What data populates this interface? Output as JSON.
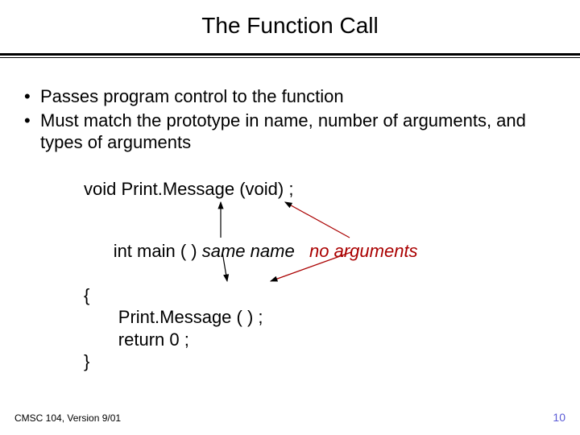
{
  "title": "The Function Call",
  "bullets": [
    "Passes program control to  the function",
    "Must match the prototype in name, number of arguments, and types of arguments"
  ],
  "code": {
    "prototype": "void Print.Message (void) ;",
    "main_sig": "int main ( )",
    "brace_open": "{",
    "call_line": "Print.Message ( ) ;",
    "return_line": "return 0 ;",
    "brace_close": "}"
  },
  "annotations": {
    "same_name": "same name",
    "no_args": "no arguments"
  },
  "footer": {
    "left": "CMSC 104, Version 9/01",
    "right": "10"
  }
}
